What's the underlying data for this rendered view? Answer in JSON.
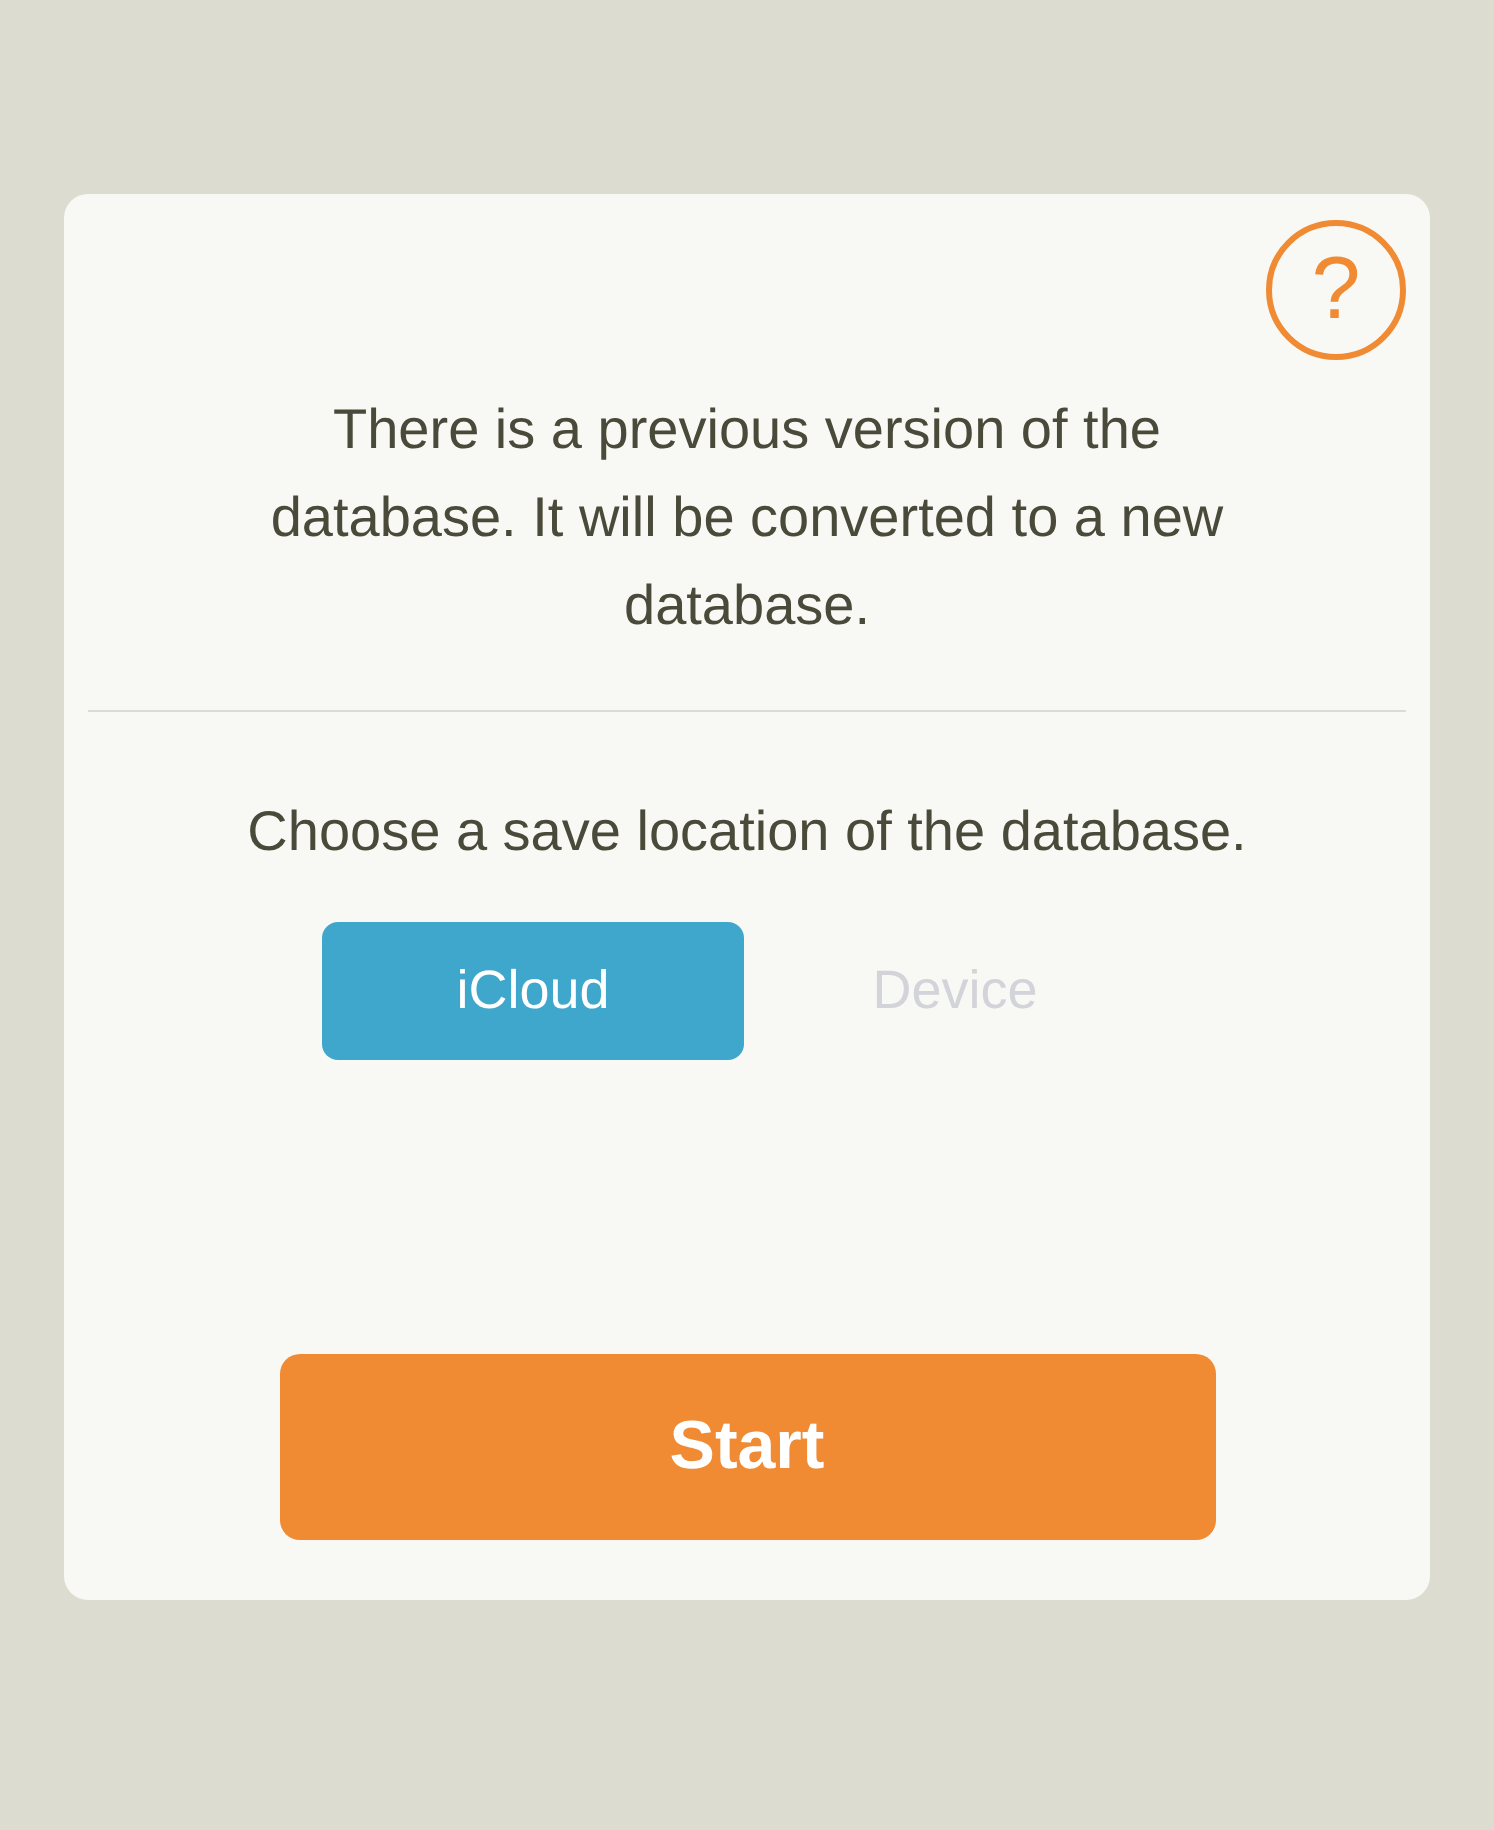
{
  "message": "There is a previous version of the database. It will be converted to a new database.",
  "help_button": {
    "label": "?"
  },
  "prompt": "Choose a save location of the database.",
  "locations": [
    {
      "label": "iCloud",
      "selected": true
    },
    {
      "label": "Device",
      "selected": false
    }
  ],
  "start_button": {
    "label": "Start"
  }
}
